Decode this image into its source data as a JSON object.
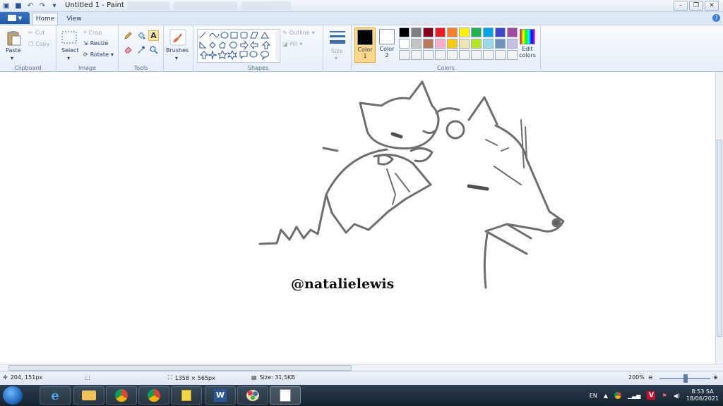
{
  "window": {
    "title": "Untitled 1 - Paint",
    "menu_tabs": [
      "Home",
      "View"
    ]
  },
  "ribbon": {
    "clipboard": {
      "label": "Clipboard",
      "paste": "Paste",
      "cut": "Cut",
      "copy": "Copy"
    },
    "image": {
      "label": "Image",
      "select": "Select",
      "crop": "Crop",
      "resize": "Resize",
      "rotate": "Rotate"
    },
    "tools": {
      "label": "Tools"
    },
    "brushes": {
      "label": "Brushes"
    },
    "shapes": {
      "label": "Shapes",
      "outline": "Outline",
      "fill": "Fill"
    },
    "size": {
      "label": "Size"
    },
    "colors": {
      "label": "Colors",
      "color1": "Color 1",
      "color2": "Color 2",
      "edit": "Edit colors",
      "color1_value": "#000000",
      "color2_value": "#ffffff",
      "palette": [
        "#000000",
        "#7f7f7f",
        "#880015",
        "#ed1c24",
        "#ff7f27",
        "#fff200",
        "#22b14c",
        "#00a2e8",
        "#3f48cc",
        "#a349a4",
        "#ffffff",
        "#c3c3c3",
        "#b97a57",
        "#ffaec9",
        "#ffc90e",
        "#efe4b0",
        "#b5e61d",
        "#99d9ea",
        "#7092be",
        "#c8bfe7",
        "#f2f2f2",
        "#f2f2f2",
        "#f2f2f2",
        "#f2f2f2",
        "#f2f2f2",
        "#f2f2f2",
        "#f2f2f2",
        "#f2f2f2",
        "#f2f2f2",
        "#f2f2f2"
      ]
    }
  },
  "canvas": {
    "watermark": "@natalielewis"
  },
  "status": {
    "position": "204, 151px",
    "dimensions": "1358 × 565px",
    "size": "Size: 31,5KB",
    "zoom": "200%"
  },
  "taskbar": {
    "language": "EN",
    "time": "8:53 SA",
    "date": "18/06/2021",
    "apps": [
      "internet-explorer",
      "file-explorer",
      "chrome",
      "chrome-profile",
      "sticky-notes",
      "word",
      "paint",
      "media-app"
    ]
  }
}
